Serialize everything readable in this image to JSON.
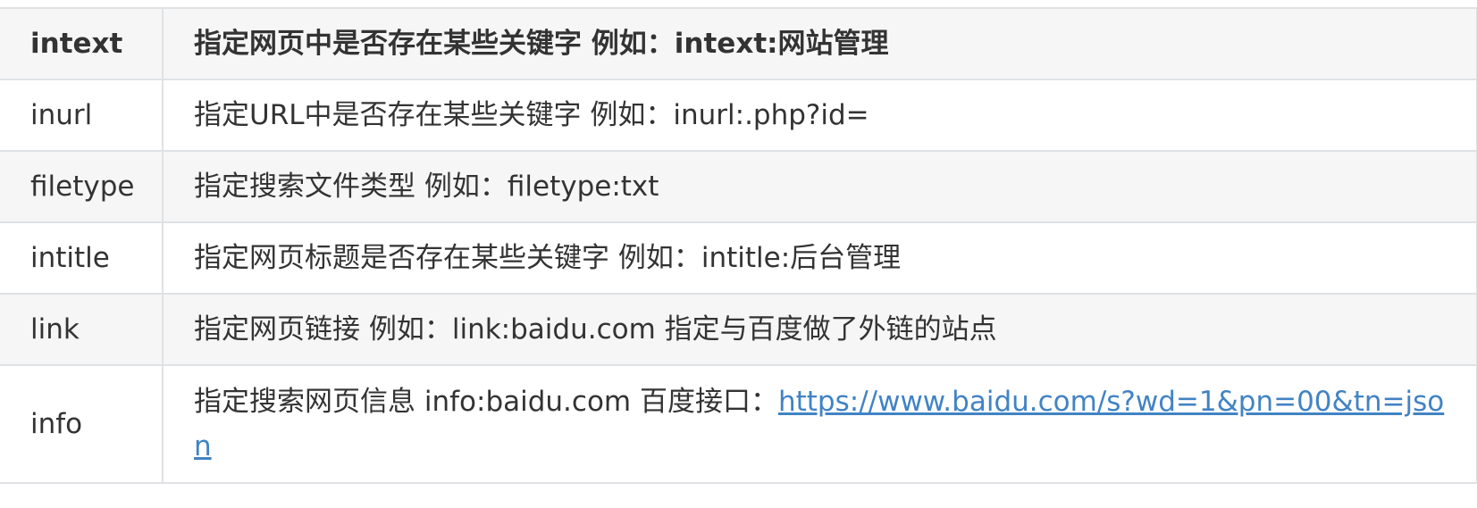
{
  "table": {
    "rows": [
      {
        "key": "intext",
        "desc": "指定网页中是否存在某些关键字 例如：intext:网站管理",
        "link": ""
      },
      {
        "key": "inurl",
        "desc": "指定URL中是否存在某些关键字 例如：inurl:.php?id=",
        "link": ""
      },
      {
        "key": "filetype",
        "desc": "指定搜索文件类型 例如：filetype:txt",
        "link": ""
      },
      {
        "key": "intitle",
        "desc": "指定网页标题是否存在某些关键字 例如：intitle:后台管理",
        "link": ""
      },
      {
        "key": "link",
        "desc": "指定网页链接 例如：link:baidu.com 指定与百度做了外链的站点",
        "link": ""
      },
      {
        "key": "info",
        "desc": "指定搜索网页信息 info:baidu.com 百度接口：",
        "link": "https://www.baidu.com/s?wd=1&pn=00&tn=json"
      }
    ]
  }
}
